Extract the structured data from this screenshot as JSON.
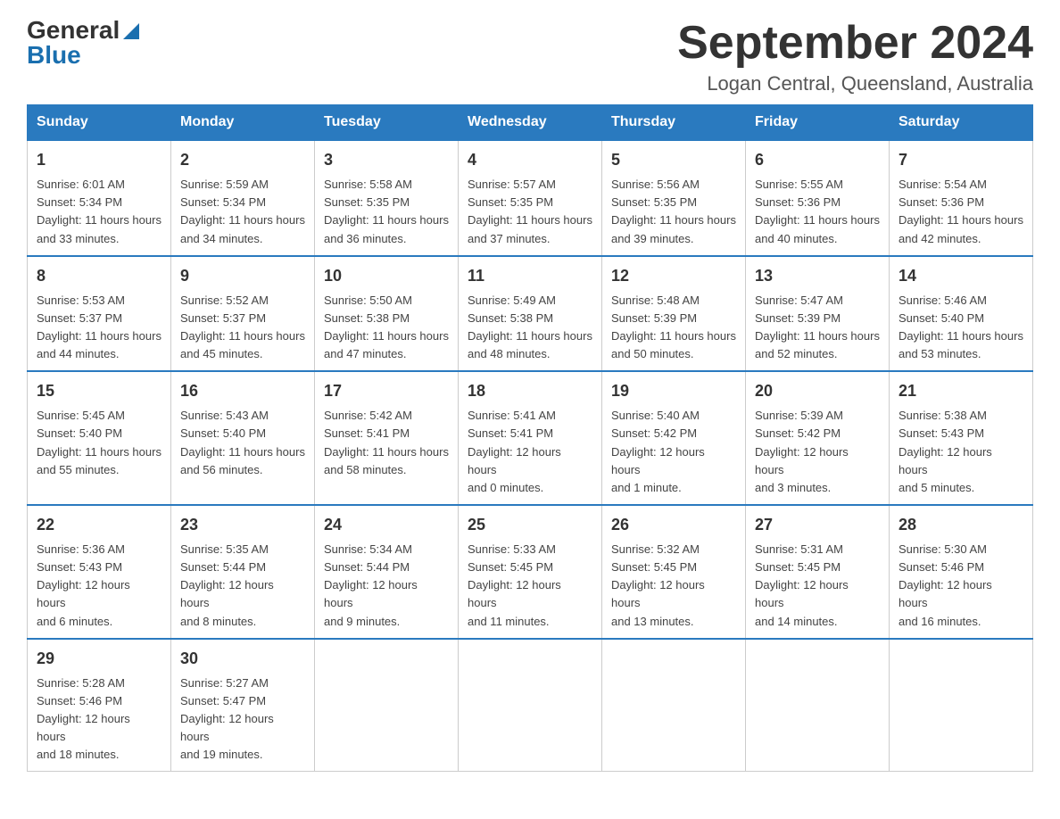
{
  "logo": {
    "general": "General",
    "blue": "Blue"
  },
  "title": "September 2024",
  "subtitle": "Logan Central, Queensland, Australia",
  "days_of_week": [
    "Sunday",
    "Monday",
    "Tuesday",
    "Wednesday",
    "Thursday",
    "Friday",
    "Saturday"
  ],
  "weeks": [
    [
      {
        "day": "1",
        "sunrise": "6:01 AM",
        "sunset": "5:34 PM",
        "daylight": "11 hours and 33 minutes."
      },
      {
        "day": "2",
        "sunrise": "5:59 AM",
        "sunset": "5:34 PM",
        "daylight": "11 hours and 34 minutes."
      },
      {
        "day": "3",
        "sunrise": "5:58 AM",
        "sunset": "5:35 PM",
        "daylight": "11 hours and 36 minutes."
      },
      {
        "day": "4",
        "sunrise": "5:57 AM",
        "sunset": "5:35 PM",
        "daylight": "11 hours and 37 minutes."
      },
      {
        "day": "5",
        "sunrise": "5:56 AM",
        "sunset": "5:35 PM",
        "daylight": "11 hours and 39 minutes."
      },
      {
        "day": "6",
        "sunrise": "5:55 AM",
        "sunset": "5:36 PM",
        "daylight": "11 hours and 40 minutes."
      },
      {
        "day": "7",
        "sunrise": "5:54 AM",
        "sunset": "5:36 PM",
        "daylight": "11 hours and 42 minutes."
      }
    ],
    [
      {
        "day": "8",
        "sunrise": "5:53 AM",
        "sunset": "5:37 PM",
        "daylight": "11 hours and 44 minutes."
      },
      {
        "day": "9",
        "sunrise": "5:52 AM",
        "sunset": "5:37 PM",
        "daylight": "11 hours and 45 minutes."
      },
      {
        "day": "10",
        "sunrise": "5:50 AM",
        "sunset": "5:38 PM",
        "daylight": "11 hours and 47 minutes."
      },
      {
        "day": "11",
        "sunrise": "5:49 AM",
        "sunset": "5:38 PM",
        "daylight": "11 hours and 48 minutes."
      },
      {
        "day": "12",
        "sunrise": "5:48 AM",
        "sunset": "5:39 PM",
        "daylight": "11 hours and 50 minutes."
      },
      {
        "day": "13",
        "sunrise": "5:47 AM",
        "sunset": "5:39 PM",
        "daylight": "11 hours and 52 minutes."
      },
      {
        "day": "14",
        "sunrise": "5:46 AM",
        "sunset": "5:40 PM",
        "daylight": "11 hours and 53 minutes."
      }
    ],
    [
      {
        "day": "15",
        "sunrise": "5:45 AM",
        "sunset": "5:40 PM",
        "daylight": "11 hours and 55 minutes."
      },
      {
        "day": "16",
        "sunrise": "5:43 AM",
        "sunset": "5:40 PM",
        "daylight": "11 hours and 56 minutes."
      },
      {
        "day": "17",
        "sunrise": "5:42 AM",
        "sunset": "5:41 PM",
        "daylight": "11 hours and 58 minutes."
      },
      {
        "day": "18",
        "sunrise": "5:41 AM",
        "sunset": "5:41 PM",
        "daylight": "12 hours and 0 minutes."
      },
      {
        "day": "19",
        "sunrise": "5:40 AM",
        "sunset": "5:42 PM",
        "daylight": "12 hours and 1 minute."
      },
      {
        "day": "20",
        "sunrise": "5:39 AM",
        "sunset": "5:42 PM",
        "daylight": "12 hours and 3 minutes."
      },
      {
        "day": "21",
        "sunrise": "5:38 AM",
        "sunset": "5:43 PM",
        "daylight": "12 hours and 5 minutes."
      }
    ],
    [
      {
        "day": "22",
        "sunrise": "5:36 AM",
        "sunset": "5:43 PM",
        "daylight": "12 hours and 6 minutes."
      },
      {
        "day": "23",
        "sunrise": "5:35 AM",
        "sunset": "5:44 PM",
        "daylight": "12 hours and 8 minutes."
      },
      {
        "day": "24",
        "sunrise": "5:34 AM",
        "sunset": "5:44 PM",
        "daylight": "12 hours and 9 minutes."
      },
      {
        "day": "25",
        "sunrise": "5:33 AM",
        "sunset": "5:45 PM",
        "daylight": "12 hours and 11 minutes."
      },
      {
        "day": "26",
        "sunrise": "5:32 AM",
        "sunset": "5:45 PM",
        "daylight": "12 hours and 13 minutes."
      },
      {
        "day": "27",
        "sunrise": "5:31 AM",
        "sunset": "5:45 PM",
        "daylight": "12 hours and 14 minutes."
      },
      {
        "day": "28",
        "sunrise": "5:30 AM",
        "sunset": "5:46 PM",
        "daylight": "12 hours and 16 minutes."
      }
    ],
    [
      {
        "day": "29",
        "sunrise": "5:28 AM",
        "sunset": "5:46 PM",
        "daylight": "12 hours and 18 minutes."
      },
      {
        "day": "30",
        "sunrise": "5:27 AM",
        "sunset": "5:47 PM",
        "daylight": "12 hours and 19 minutes."
      },
      null,
      null,
      null,
      null,
      null
    ]
  ],
  "labels": {
    "sunrise": "Sunrise:",
    "sunset": "Sunset:",
    "daylight": "Daylight:"
  }
}
